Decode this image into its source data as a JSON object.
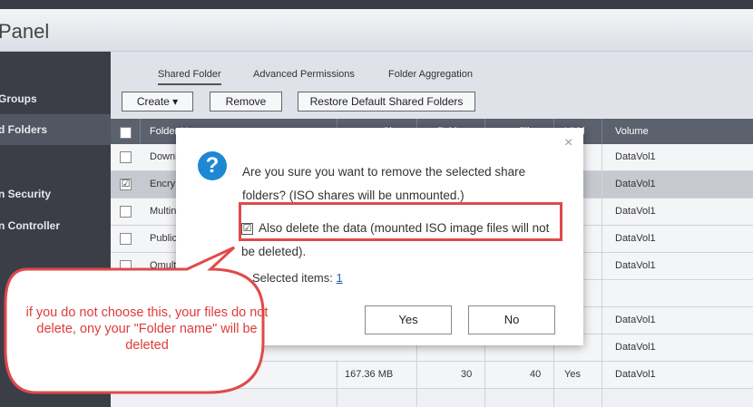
{
  "app": {
    "title": "Panel"
  },
  "sidebar": {
    "items": [
      {
        "label": "Groups"
      },
      {
        "label": "d Folders"
      },
      {
        "label": "n Security"
      },
      {
        "label": "n Controller"
      }
    ]
  },
  "tabs": [
    {
      "label": "Shared Folder"
    },
    {
      "label": "Advanced Permissions"
    },
    {
      "label": "Folder Aggregation"
    }
  ],
  "toolbar": {
    "create_label": "Create ▾",
    "remove_label": "Remove",
    "restore_label": "Restore Default Shared Folders"
  },
  "table": {
    "headers": {
      "name": "Folder N",
      "size": "Siz",
      "folders": "Folde",
      "files": "Fil",
      "hidden": "Hidd",
      "volume": "Volume"
    },
    "rows": [
      {
        "name": "Downl",
        "volume": "DataVol1",
        "checked": ""
      },
      {
        "name": "Encry",
        "volume": "DataVol1",
        "checked": "☑"
      },
      {
        "name": "Multin",
        "volume": "DataVol1",
        "checked": ""
      },
      {
        "name": "Public",
        "volume": "DataVol1",
        "checked": ""
      },
      {
        "name": "Qmult",
        "volume": "DataVol1",
        "checked": ""
      },
      {
        "name": "",
        "volume": "",
        "checked": ""
      },
      {
        "name": "",
        "volume": "DataVol1",
        "checked": ""
      },
      {
        "name": "",
        "volume": "DataVol1",
        "checked": ""
      },
      {
        "name": "",
        "size": "167.36 MB",
        "folders": "30",
        "files": "40",
        "hidden": "Yes",
        "volume": "DataVol1",
        "checked": ""
      }
    ]
  },
  "dialog": {
    "close": "×",
    "icon_glyph": "?",
    "message": "Are you sure you want to remove the selected share folders? (ISO shares will be unmounted.)",
    "checkbox_mark": "☑",
    "option_label": "Also delete the data (mounted ISO image files will not be deleted).",
    "selected_label": "Selected items:",
    "selected_count": "1",
    "yes_label": "Yes",
    "no_label": "No"
  },
  "annotation": {
    "text": "if you do  not choose this, your files do not delete, ony your \"Folder name\" will be deleted"
  },
  "colors": {
    "accent": "#1e88d4",
    "highlight": "#e04a4a",
    "header": "#5c616e",
    "sidebar": "#3b3e47"
  }
}
